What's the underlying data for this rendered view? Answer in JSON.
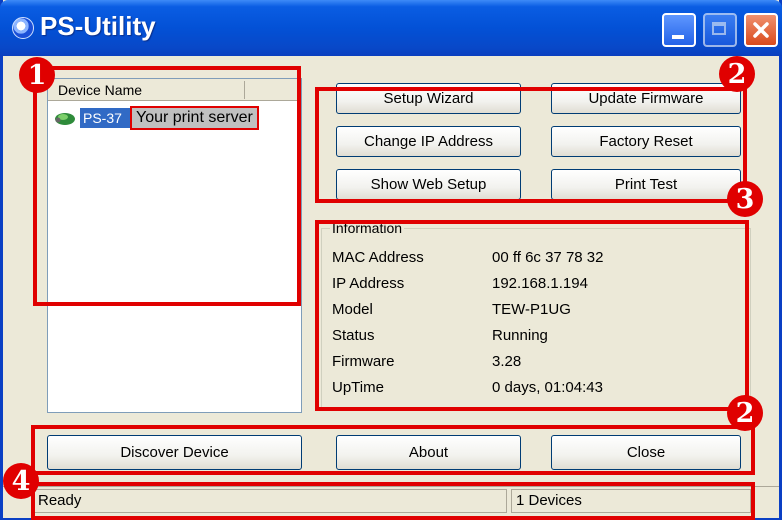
{
  "window": {
    "title": "PS-Utility",
    "app_icon": "globe-icon"
  },
  "titlebar_buttons": {
    "minimize_icon": "minimize-icon",
    "maximize_icon": "maximize-icon",
    "close_icon": "close-icon"
  },
  "device_list": {
    "column_header": "Device Name",
    "items": [
      {
        "label": "PS-37",
        "icon": "print-server-icon"
      }
    ],
    "tooltip": "Your print server"
  },
  "buttons": {
    "setup_wizard": "Setup Wizard",
    "update_firmware": "Update Firmware",
    "change_ip": "Change IP Address",
    "factory_reset": "Factory Reset",
    "show_web_setup": "Show Web Setup",
    "print_test": "Print Test",
    "discover_device": "Discover Device",
    "about": "About",
    "close": "Close"
  },
  "information": {
    "title": "Information",
    "rows": [
      {
        "label": "MAC Address",
        "value": "00 ff 6c 37 78 32"
      },
      {
        "label": "IP Address",
        "value": "192.168.1.194"
      },
      {
        "label": "Model",
        "value": "TEW-P1UG"
      },
      {
        "label": "Status",
        "value": "Running"
      },
      {
        "label": "Firmware",
        "value": "3.28"
      },
      {
        "label": "UpTime",
        "value": "0 days, 01:04:43"
      }
    ]
  },
  "statusbar": {
    "left": "Ready",
    "right": "1 Devices"
  },
  "callouts": [
    "1",
    "2",
    "3",
    "2",
    "4"
  ],
  "colors": {
    "titlebar": "#0351d6",
    "selection": "#316ac5",
    "callout": "#e00000"
  }
}
